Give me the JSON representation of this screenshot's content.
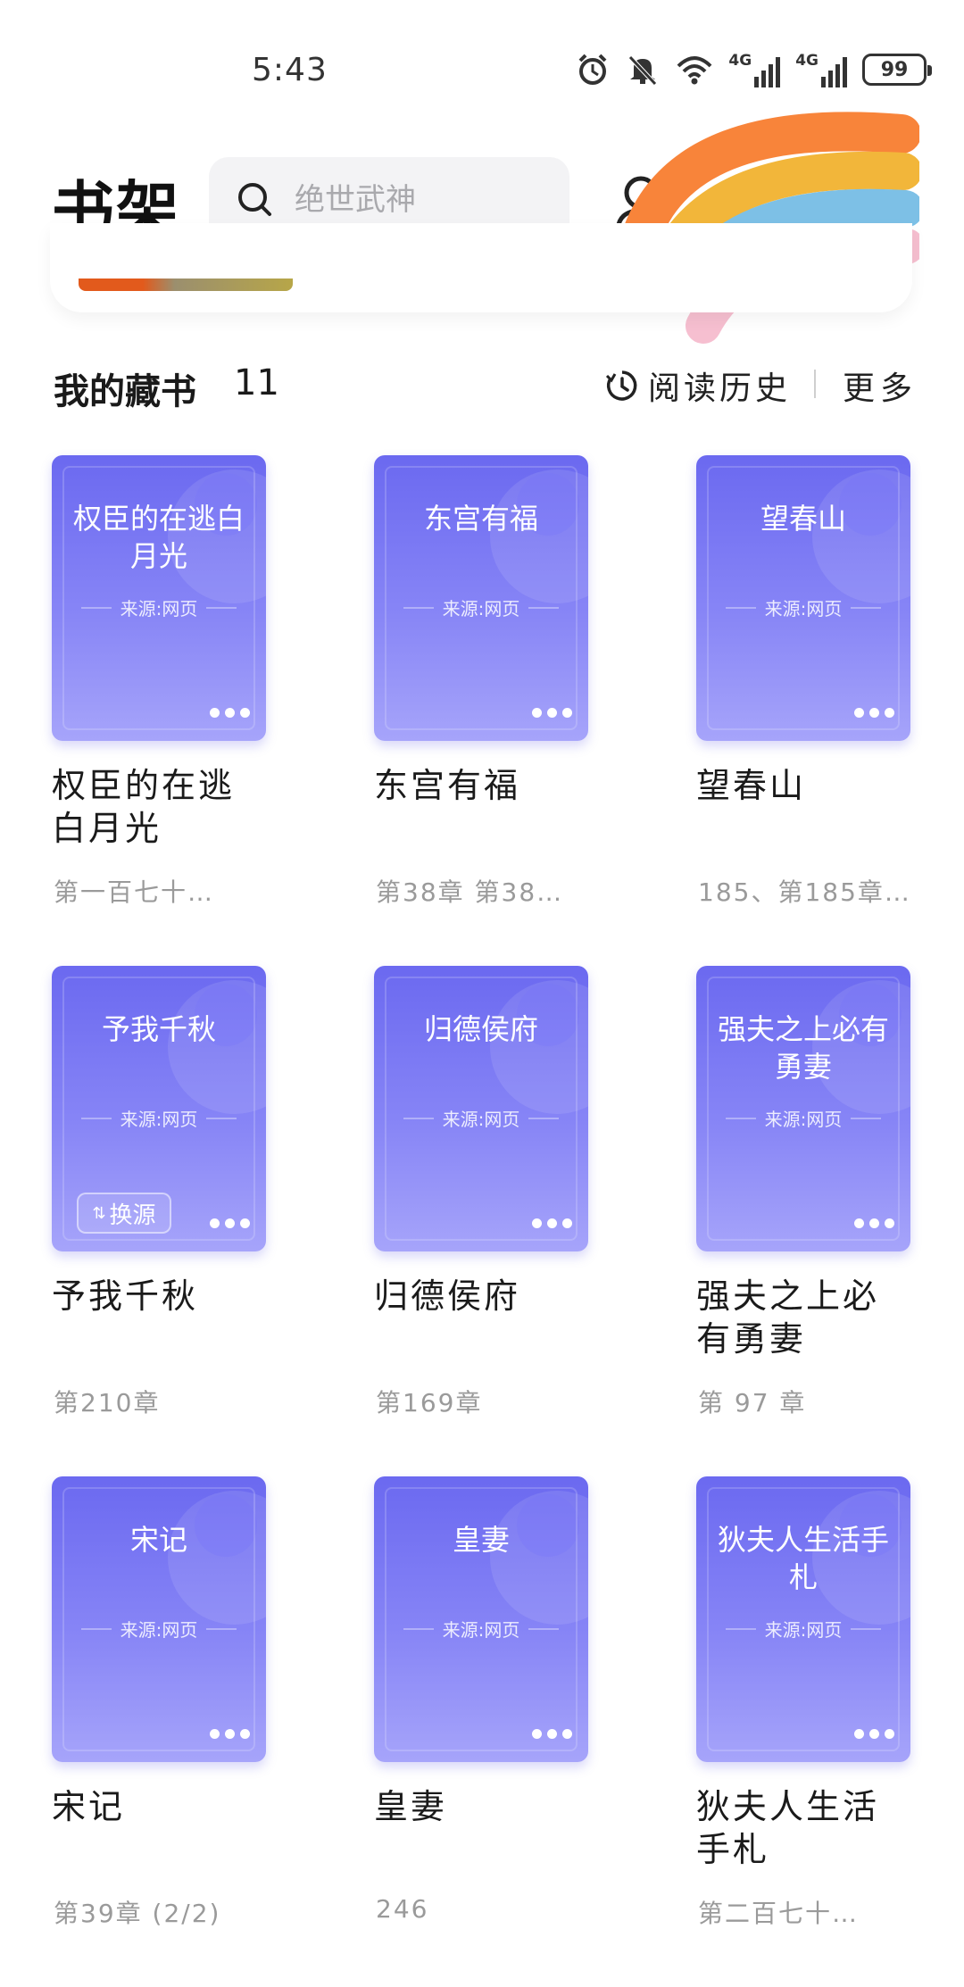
{
  "status_bar": {
    "time": "5:43",
    "battery": "99",
    "network1": "4G",
    "network2": "4G"
  },
  "header": {
    "title": "书架",
    "search_placeholder": "绝世武神"
  },
  "section": {
    "title": "我的藏书",
    "count": "11",
    "history_label": "阅读历史",
    "more_label": "更多"
  },
  "books": [
    {
      "cover_title": "权臣的在逃白月光",
      "source": "来源:网页",
      "name": "权臣的在逃白月光",
      "progress": "第一百七十…"
    },
    {
      "cover_title": "东宫有福",
      "source": "来源:网页",
      "name": "东宫有福",
      "progress": "第38章 第38…"
    },
    {
      "cover_title": "望春山",
      "source": "来源:网页",
      "name": "望春山",
      "progress": "185、第185章…"
    },
    {
      "cover_title": "予我千秋",
      "source": "来源:网页",
      "name": "予我千秋",
      "progress": "第210章",
      "switch_label": "换源"
    },
    {
      "cover_title": "归德侯府",
      "source": "来源:网页",
      "name": "归德侯府",
      "progress": "第169章"
    },
    {
      "cover_title": "强夫之上必有勇妻",
      "source": "来源:网页",
      "name": "强夫之上必有勇妻",
      "progress": "第 97 章"
    },
    {
      "cover_title": "宋记",
      "source": "来源:网页",
      "name": "宋记",
      "progress": "第39章 (2/2)"
    },
    {
      "cover_title": "皇妻",
      "source": "来源:网页",
      "name": "皇妻",
      "progress": "246"
    },
    {
      "cover_title": "狄夫人生活手札",
      "source": "来源:网页",
      "name": "狄夫人生活手札",
      "progress": "第二百七十…"
    }
  ],
  "colors": {
    "cover_top": "#6b69f0",
    "cover_bottom": "#a6a4fa",
    "progress_text": "#9a9a9a"
  }
}
